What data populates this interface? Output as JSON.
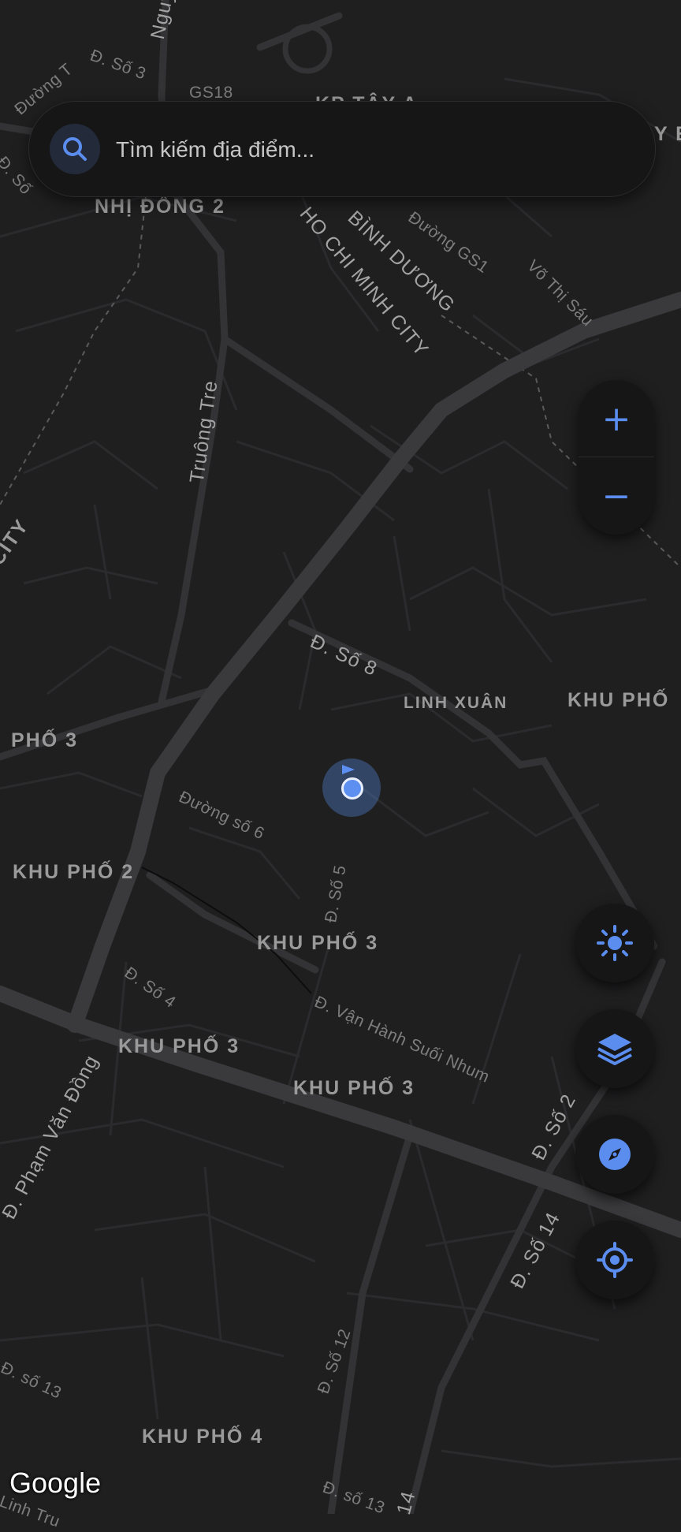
{
  "search": {
    "placeholder": "Tìm kiếm địa điểm..."
  },
  "map_labels": {
    "gs18": "GS18",
    "d_so3_top": "Đ. Số 3",
    "duong_t": "Đường T",
    "nguy": "Nguy",
    "kp_tay": "KP TÂY A",
    "y_e": "Y E",
    "so_left": "Đ. Số",
    "nhi_dong_2": "NHỊ ĐỒNG 2",
    "binh_duong": "BÌNH DƯƠNG",
    "hcm_city": "HO CHI MINH CITY",
    "duong_gs1": "Đường GS1",
    "vo_thi_sau": "Võ Thị Sáu",
    "truong_tre": "Truông Tre",
    "city_left": "CITY",
    "d_so_8": "Đ. Số 8",
    "linh_xuan": "LINH XUÂN",
    "khu_pho_right": "KHU PHỐ",
    "pho_3": "PHỐ 3",
    "duong_so_6": "Đường số 6",
    "khu_pho_2": "KHU PHỐ 2",
    "d_so_5": "Đ. Số 5",
    "khu_pho_3_a": "KHU PHỐ 3",
    "d_so_4": "Đ. Số 4",
    "van_hanh": "Đ. Vận Hành Suối Nhum",
    "khu_pho_3_b": "KHU PHỐ 3",
    "khu_pho_3_c": "KHU PHỐ 3",
    "pham_van_dong": "Đ. Phạm Văn Đồng",
    "d_so_2": "Đ. Số 2",
    "d_so_14": "Đ. Số 14",
    "d_so_12": "Đ. Số 12",
    "d_so_13_left": "Đ. số 13",
    "khu_pho_4": "KHU PHỐ 4",
    "d_so_13_bottom": "Đ. số 13",
    "d_14_bottom": "14",
    "linh_tru": "Linh Tru"
  },
  "controls": {
    "zoom_in": "+",
    "zoom_out": "−"
  },
  "attribution": "Google",
  "colors": {
    "accent": "#5b8def",
    "background": "#1f1f20",
    "panel": "#161617",
    "road_major": "#3a3a3c",
    "road_minor": "#2c2c2e"
  },
  "icons": [
    "search-icon",
    "brightness-icon",
    "layers-icon",
    "compass-icon",
    "my-location-icon"
  ]
}
